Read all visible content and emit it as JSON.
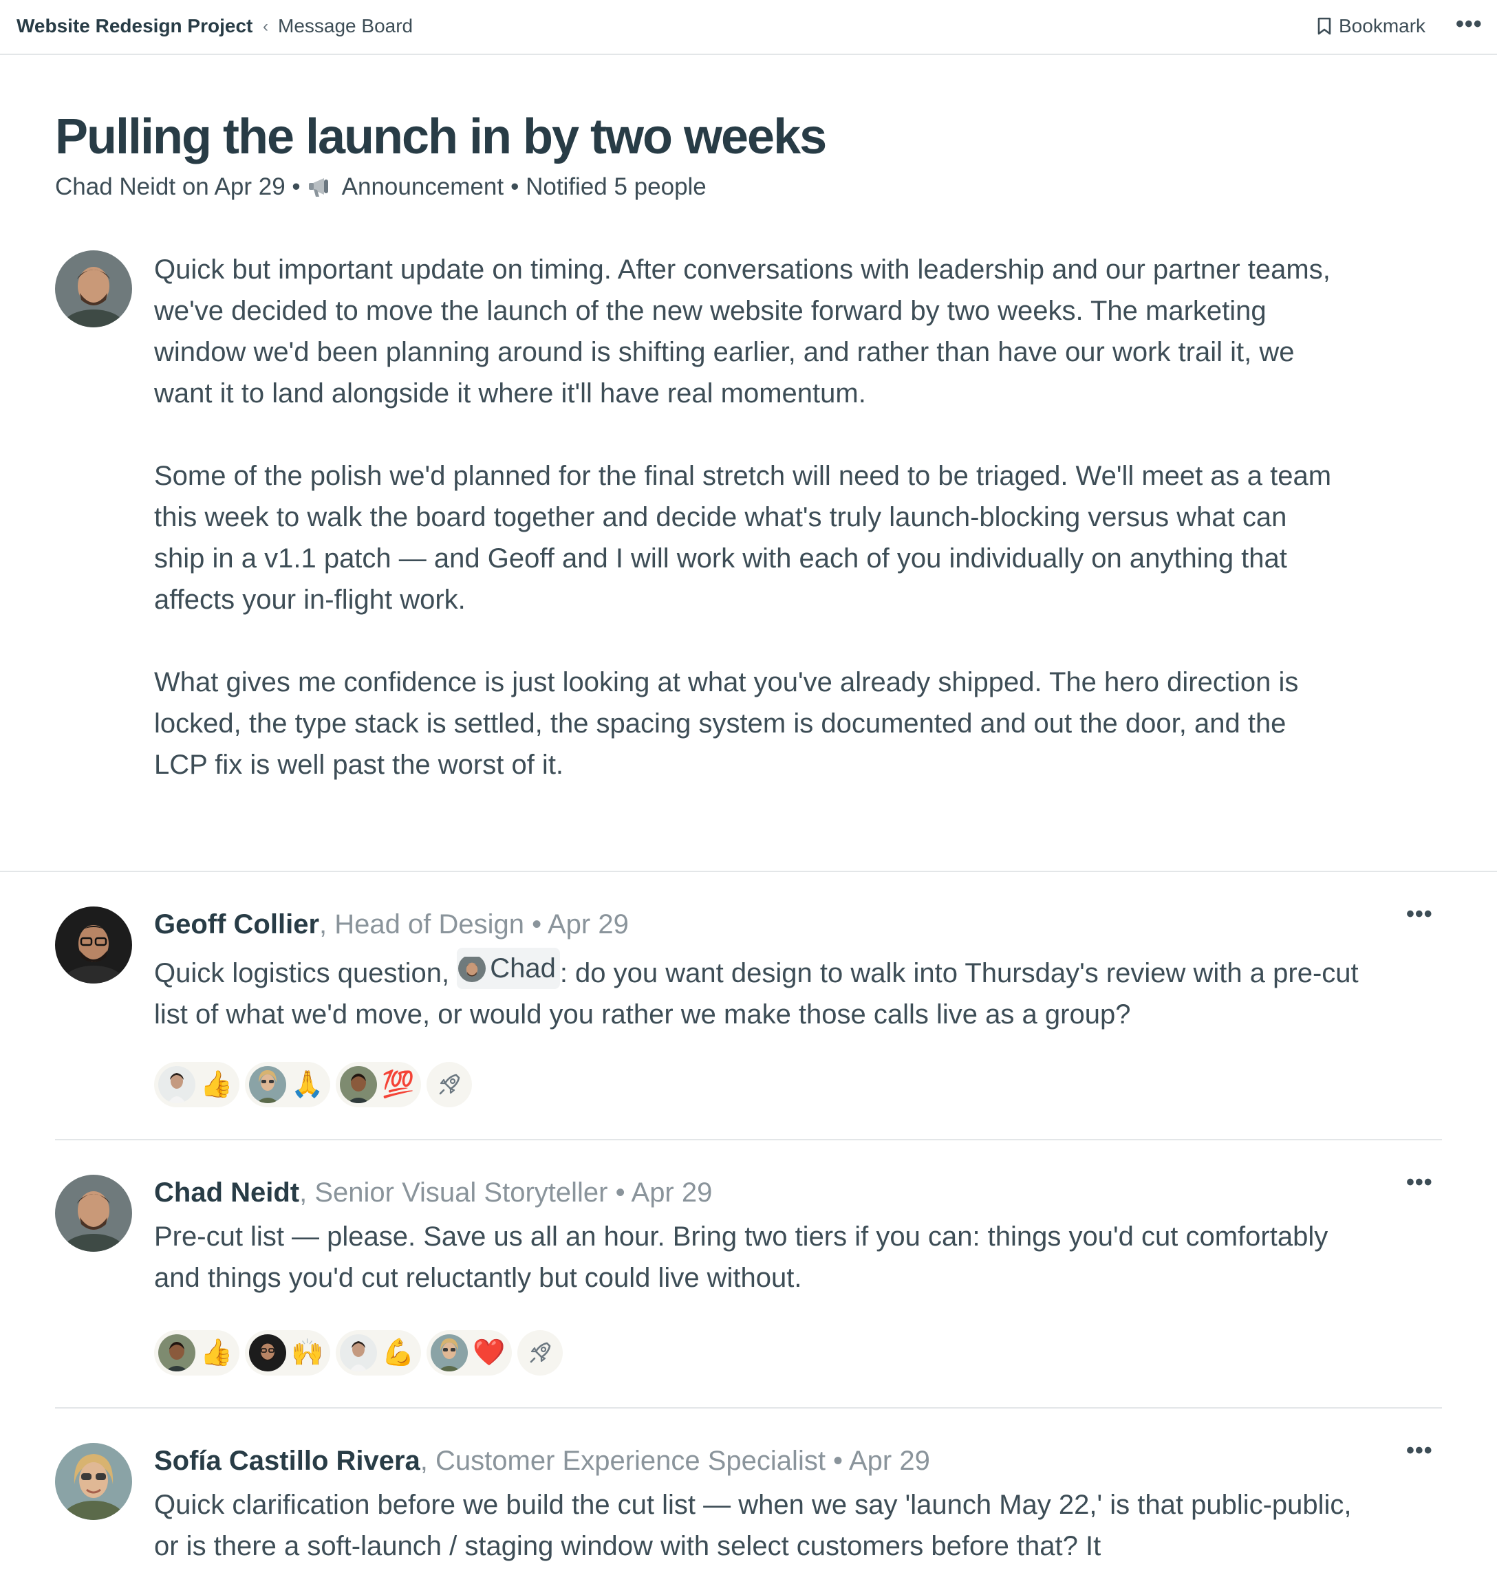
{
  "breadcrumb": {
    "project": "Website Redesign Project",
    "separator": "‹",
    "section": "Message Board"
  },
  "toolbar": {
    "bookmark_label": "Bookmark",
    "more_label": "•••"
  },
  "post": {
    "title": "Pulling the launch in by two weeks",
    "meta_author_date": "Chad Neidt on Apr 29 •",
    "meta_category": "Announcement",
    "meta_notified": "• Notified 5 people",
    "paragraphs": [
      "Quick but important update on timing. After conversations with leadership and our partner teams, we've decided to move the launch of the new website forward by two weeks. The marketing window we'd been planning around is shifting earlier, and rather than have our work trail it, we want it to land alongside it where it'll have real momentum.",
      "Some of the polish we'd planned for the final stretch will need to be triaged. We'll meet as a team this week to walk the board together and decide what's truly launch-blocking versus what can ship in a v1.1 patch — and Geoff and I will work with each of you individually on anything that affects your in-flight work.",
      "What gives me confidence is just looking at what you've already shipped. The hero direction is locked, the type stack is settled, the spacing system is documented and out the door, and the LCP fix is well past the worst of it."
    ]
  },
  "comments": [
    {
      "author": "Geoff Collier",
      "role": ", Head of Design • Apr 29",
      "text_before": "Quick logistics question, ",
      "mention": "Chad",
      "text_after": ": do you want design to walk into Thursday's review with a pre-cut list of what we'd move, or would you rather we make those calls live as a group?",
      "reactions": [
        "👍",
        "🙏",
        "💯"
      ]
    },
    {
      "author": "Chad Neidt",
      "role": ", Senior Visual Storyteller • Apr 29",
      "text": "Pre-cut list — please. Save us all an hour. Bring two tiers if you can: things you'd cut comfortably and things you'd cut reluctantly but could live without.",
      "reactions": [
        "👍",
        "🙌",
        "💪",
        "❤️"
      ]
    },
    {
      "author": "Sofía Castillo Rivera",
      "role": ", Customer Experience Specialist • Apr 29",
      "text": "Quick clarification before we build the cut list — when we say 'launch May 22,' is that public-public, or is there a soft-launch / staging window with select customers before that? It"
    }
  ],
  "colors": {
    "text": "#283c46",
    "muted": "#8a949b",
    "divider": "#e3e6e8",
    "reaction_bg": "#f6f5f0"
  },
  "icons": {
    "bookmark": "bookmark-icon",
    "category": "megaphone-icon",
    "more": "more-icon",
    "add_reaction": "rocket-icon"
  }
}
